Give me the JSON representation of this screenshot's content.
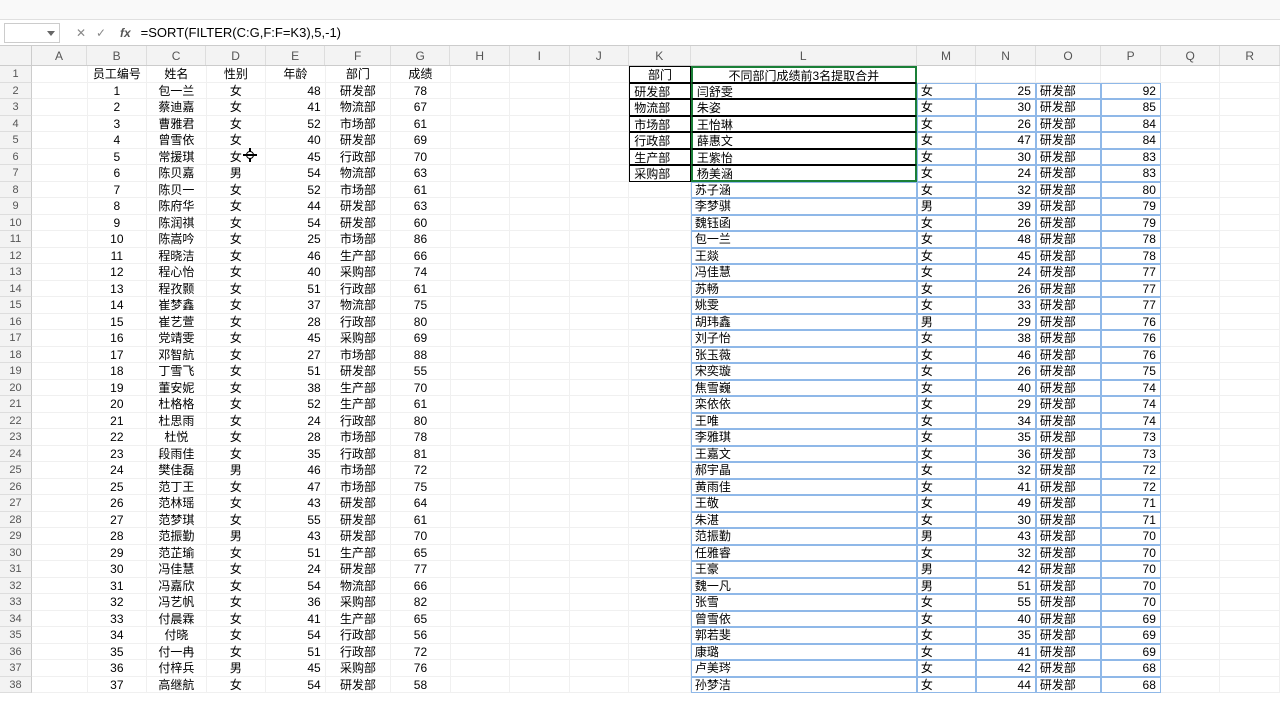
{
  "formula": "=SORT(FILTER(C:G,F:F=K3),5,-1)",
  "col_widths": {
    "row_hdr": 32,
    "A": 56,
    "B": 60,
    "C": 60,
    "D": 60,
    "E": 60,
    "F": 66,
    "G": 60,
    "H": 60,
    "I": 60,
    "J": 60,
    "K": 62,
    "L": 228,
    "M": 60,
    "N": 60,
    "O": 66,
    "P": 60,
    "Q": 60,
    "R": 60
  },
  "columns": [
    "A",
    "B",
    "C",
    "D",
    "E",
    "F",
    "G",
    "H",
    "I",
    "J",
    "K",
    "L",
    "M",
    "N",
    "O",
    "P",
    "Q",
    "R"
  ],
  "header_row": {
    "B": "员工编号",
    "C": "姓名",
    "D": "性别",
    "E": "年龄",
    "F": "部门",
    "G": "成绩",
    "K": "部门",
    "L": "不同部门成绩前3名提取合并"
  },
  "k_cells": [
    "研发部",
    "物流部",
    "市场部",
    "行政部",
    "生产部",
    "采购部"
  ],
  "left_rows": [
    [
      1,
      "包一兰",
      "女",
      48,
      "研发部",
      78
    ],
    [
      2,
      "蔡迪嘉",
      "女",
      41,
      "物流部",
      67
    ],
    [
      3,
      "曹雅君",
      "女",
      52,
      "市场部",
      61
    ],
    [
      4,
      "曾雪依",
      "女",
      40,
      "研发部",
      69
    ],
    [
      5,
      "常援琪",
      "女",
      45,
      "行政部",
      70
    ],
    [
      6,
      "陈贝嘉",
      "男",
      54,
      "物流部",
      63
    ],
    [
      7,
      "陈贝一",
      "女",
      52,
      "市场部",
      61
    ],
    [
      8,
      "陈府华",
      "女",
      44,
      "研发部",
      63
    ],
    [
      9,
      "陈润祺",
      "女",
      54,
      "研发部",
      60
    ],
    [
      10,
      "陈嵩吟",
      "女",
      25,
      "市场部",
      86
    ],
    [
      11,
      "程晓洁",
      "女",
      46,
      "生产部",
      66
    ],
    [
      12,
      "程心怡",
      "女",
      40,
      "采购部",
      74
    ],
    [
      13,
      "程孜颢",
      "女",
      51,
      "行政部",
      61
    ],
    [
      14,
      "崔梦鑫",
      "女",
      37,
      "物流部",
      75
    ],
    [
      15,
      "崔艺萱",
      "女",
      28,
      "行政部",
      80
    ],
    [
      16,
      "党靖雯",
      "女",
      45,
      "采购部",
      69
    ],
    [
      17,
      "邓智航",
      "女",
      27,
      "市场部",
      88
    ],
    [
      18,
      "丁雪飞",
      "女",
      51,
      "研发部",
      55
    ],
    [
      19,
      "董安妮",
      "女",
      38,
      "生产部",
      70
    ],
    [
      20,
      "杜格格",
      "女",
      52,
      "生产部",
      61
    ],
    [
      21,
      "杜思雨",
      "女",
      24,
      "行政部",
      80
    ],
    [
      22,
      "杜悦",
      "女",
      28,
      "市场部",
      78
    ],
    [
      23,
      "段雨佳",
      "女",
      35,
      "行政部",
      81
    ],
    [
      24,
      "樊佳磊",
      "男",
      46,
      "市场部",
      72
    ],
    [
      25,
      "范丁王",
      "女",
      47,
      "市场部",
      75
    ],
    [
      26,
      "范林瑶",
      "女",
      43,
      "研发部",
      64
    ],
    [
      27,
      "范梦琪",
      "女",
      55,
      "研发部",
      61
    ],
    [
      28,
      "范振勤",
      "男",
      43,
      "研发部",
      70
    ],
    [
      29,
      "范芷瑜",
      "女",
      51,
      "生产部",
      65
    ],
    [
      30,
      "冯佳慧",
      "女",
      24,
      "研发部",
      77
    ],
    [
      31,
      "冯嘉欣",
      "女",
      54,
      "物流部",
      66
    ],
    [
      32,
      "冯艺帆",
      "女",
      36,
      "采购部",
      82
    ],
    [
      33,
      "付晨霖",
      "女",
      41,
      "生产部",
      65
    ],
    [
      34,
      "付晓",
      "女",
      54,
      "行政部",
      56
    ],
    [
      35,
      "付一冉",
      "女",
      51,
      "行政部",
      72
    ],
    [
      36,
      "付梓兵",
      "男",
      45,
      "采购部",
      76
    ],
    [
      37,
      "高继航",
      "女",
      54,
      "研发部",
      58
    ]
  ],
  "right_rows": [
    [
      "闫舒雯",
      "女",
      25,
      "研发部",
      92
    ],
    [
      "朱姿",
      "女",
      30,
      "研发部",
      85
    ],
    [
      "王怡琳",
      "女",
      26,
      "研发部",
      84
    ],
    [
      "薛惠文",
      "女",
      47,
      "研发部",
      84
    ],
    [
      "王紫怡",
      "女",
      30,
      "研发部",
      83
    ],
    [
      "杨美涵",
      "女",
      24,
      "研发部",
      83
    ],
    [
      "苏子涵",
      "女",
      32,
      "研发部",
      80
    ],
    [
      "李梦骐",
      "男",
      39,
      "研发部",
      79
    ],
    [
      "魏钰函",
      "女",
      26,
      "研发部",
      79
    ],
    [
      "包一兰",
      "女",
      48,
      "研发部",
      78
    ],
    [
      "王燚",
      "女",
      45,
      "研发部",
      78
    ],
    [
      "冯佳慧",
      "女",
      24,
      "研发部",
      77
    ],
    [
      "苏畅",
      "女",
      26,
      "研发部",
      77
    ],
    [
      "姚雯",
      "女",
      33,
      "研发部",
      77
    ],
    [
      "胡玮鑫",
      "男",
      29,
      "研发部",
      76
    ],
    [
      "刘子怡",
      "女",
      38,
      "研发部",
      76
    ],
    [
      "张玉薇",
      "女",
      46,
      "研发部",
      76
    ],
    [
      "宋奕璇",
      "女",
      26,
      "研发部",
      75
    ],
    [
      "焦雪巍",
      "女",
      40,
      "研发部",
      74
    ],
    [
      "栾依依",
      "女",
      29,
      "研发部",
      74
    ],
    [
      "王唯",
      "女",
      34,
      "研发部",
      74
    ],
    [
      "李雅琪",
      "女",
      35,
      "研发部",
      73
    ],
    [
      "王嘉文",
      "女",
      36,
      "研发部",
      73
    ],
    [
      "郝宇晶",
      "女",
      32,
      "研发部",
      72
    ],
    [
      "黄雨佳",
      "女",
      41,
      "研发部",
      72
    ],
    [
      "王敬",
      "女",
      49,
      "研发部",
      71
    ],
    [
      "朱湛",
      "女",
      30,
      "研发部",
      71
    ],
    [
      "范振勤",
      "男",
      43,
      "研发部",
      70
    ],
    [
      "任雅睿",
      "女",
      32,
      "研发部",
      70
    ],
    [
      "王豪",
      "男",
      42,
      "研发部",
      70
    ],
    [
      "魏一凡",
      "男",
      51,
      "研发部",
      70
    ],
    [
      "张雪",
      "女",
      55,
      "研发部",
      70
    ],
    [
      "曾雪依",
      "女",
      40,
      "研发部",
      69
    ],
    [
      "郭若斐",
      "女",
      35,
      "研发部",
      69
    ],
    [
      "康璐",
      "女",
      41,
      "研发部",
      69
    ],
    [
      "卢美琌",
      "女",
      42,
      "研发部",
      68
    ],
    [
      "孙梦洁",
      "女",
      44,
      "研发部",
      68
    ]
  ]
}
